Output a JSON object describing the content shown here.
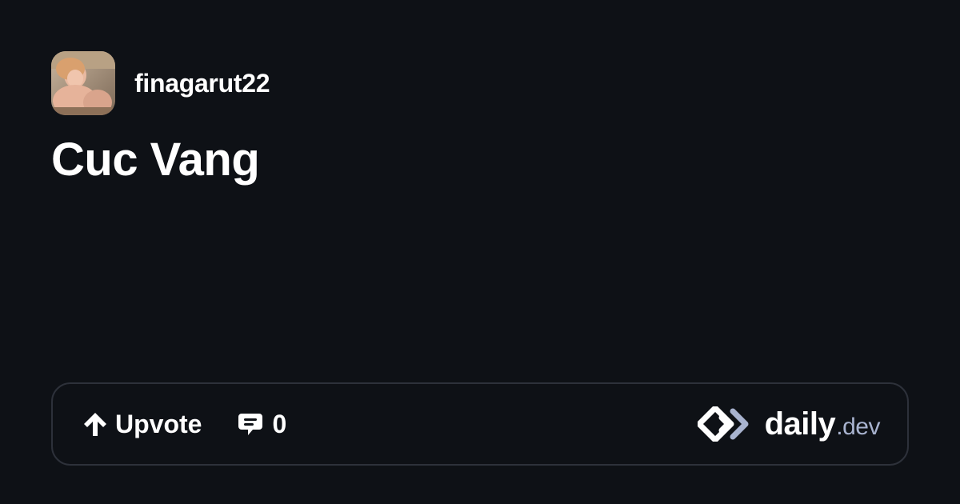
{
  "author": {
    "name": "finagarut22",
    "avatar_icon": "profile-photo"
  },
  "post": {
    "title": "Cuc Vang"
  },
  "actions": {
    "upvote_label": "Upvote",
    "upvote_icon": "arrow-up-icon",
    "comment_icon": "comment-icon",
    "comment_count": "0"
  },
  "brand": {
    "logo_icon": "daily-dev-logo-icon",
    "name": "daily",
    "suffix": ".dev"
  },
  "colors": {
    "background": "#0e1116",
    "border": "#2d313a",
    "text": "#ffffff",
    "muted": "#a8b3cf"
  }
}
